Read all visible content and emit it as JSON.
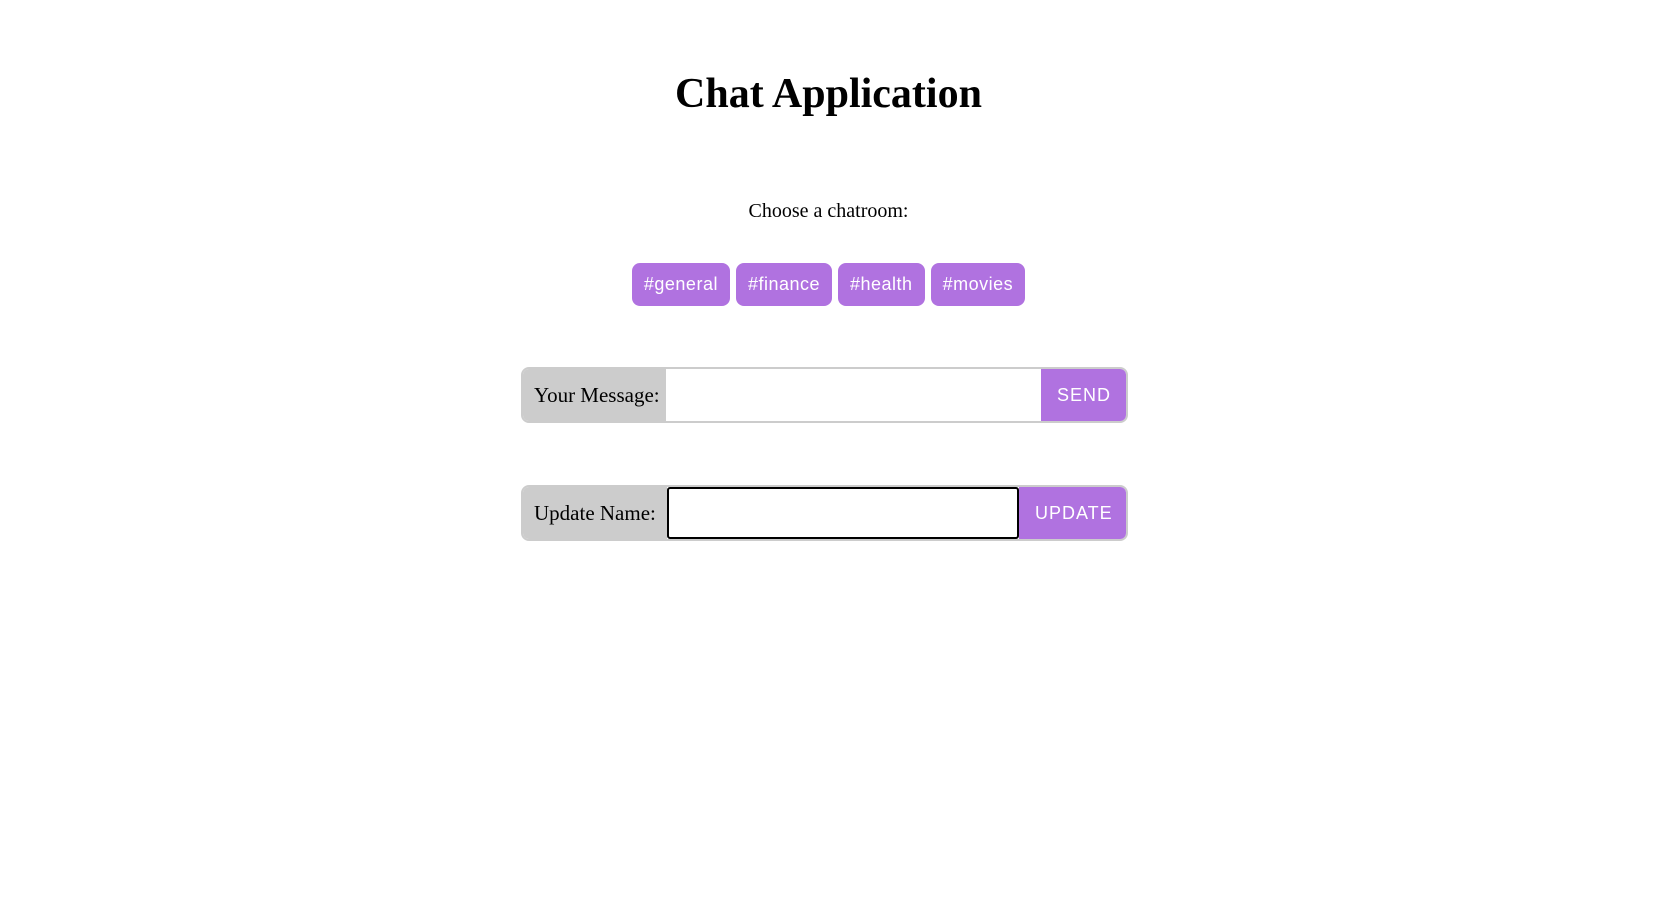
{
  "title": "Chat Application",
  "choose_label": "Choose a chatroom:",
  "rooms": [
    "#general",
    "#finance",
    "#health",
    "#movies"
  ],
  "message": {
    "label": "Your Message:",
    "value": "",
    "button": "SEND"
  },
  "name": {
    "label": "Update Name:",
    "value": "",
    "button": "UPDATE"
  },
  "colors": {
    "accent": "#b072e0",
    "label_bg": "#cccccc"
  }
}
